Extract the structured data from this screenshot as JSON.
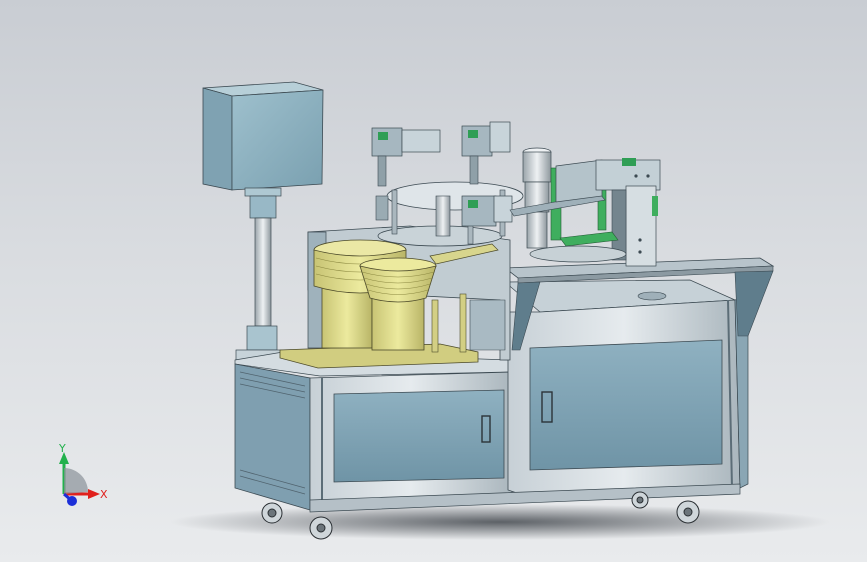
{
  "viewport": {
    "background_top": "#c9cdd3",
    "background_bottom": "#e9ebed"
  },
  "triad": {
    "x_label": "X",
    "y_label": "Y",
    "x_color": "#e0201c",
    "y_color": "#22b14c",
    "z_color": "#1c2fd8"
  },
  "machine": {
    "frame_color": "#a9b6bf",
    "panel_color": "#7fa2b3",
    "feeder_color": "#d7d38a",
    "monitor_color": "#8ab0bf"
  }
}
